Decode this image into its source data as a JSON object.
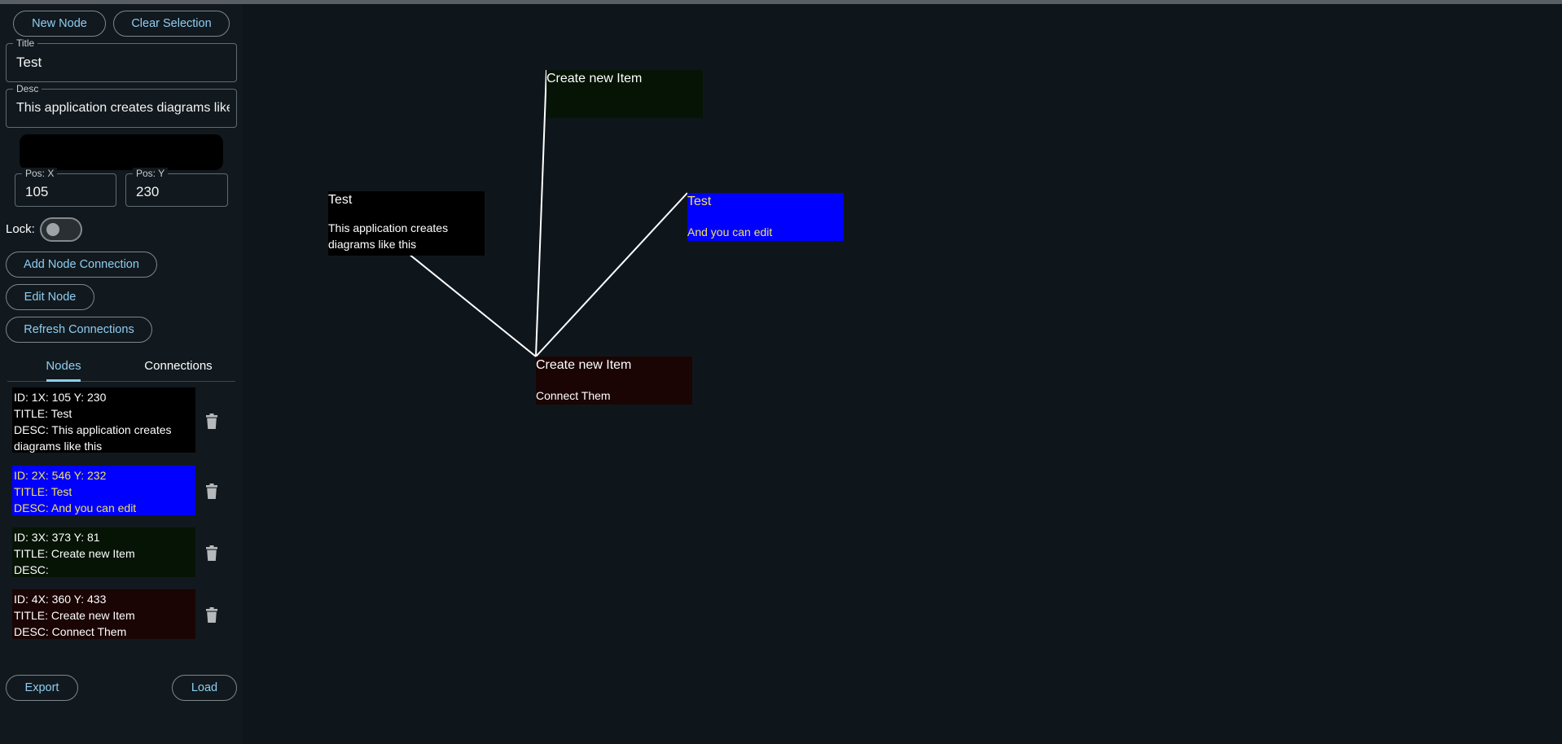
{
  "toolbar": {
    "new_node": "New Node",
    "clear_selection": "Clear Selection"
  },
  "form": {
    "title": {
      "label": "Title",
      "value": "Test"
    },
    "desc": {
      "label": "Desc",
      "value": "This application creates diagrams like this"
    },
    "pos_x": {
      "label": "Pos: X",
      "value": "105"
    },
    "pos_y": {
      "label": "Pos: Y",
      "value": "230"
    },
    "lock_label": "Lock:",
    "lock_on": false
  },
  "actions": {
    "add_connection": "Add Node Connection",
    "edit_node": "Edit Node",
    "refresh_connections": "Refresh Connections"
  },
  "tabs": {
    "nodes": "Nodes",
    "connections": "Connections",
    "active": "nodes"
  },
  "node_list": [
    {
      "id_line": "ID: 1X: 105 Y: 230",
      "title_line": "TITLE: Test",
      "desc_line": "DESC: This application creates",
      "desc_line2": "diagrams like this",
      "bg": "#000000",
      "fg": "#ffffff"
    },
    {
      "id_line": "ID: 2X: 546 Y: 232",
      "title_line": "TITLE: Test",
      "desc_line": "DESC: And you can edit",
      "bg": "#0000ff",
      "fg": "#f3e35a"
    },
    {
      "id_line": "ID: 3X: 373 Y: 81",
      "title_line": "TITLE: Create new Item",
      "desc_line": "DESC:",
      "bg": "#061406",
      "fg": "#ffffff"
    },
    {
      "id_line": "ID: 4X: 360 Y: 433",
      "title_line": "TITLE: Create new Item",
      "desc_line": "DESC: Connect Them",
      "bg": "#1a0404",
      "fg": "#ffffff"
    }
  ],
  "footer": {
    "export": "Export",
    "load": "Load"
  },
  "diagram": {
    "nodes": [
      {
        "title": "Test",
        "desc": "This application creates diagrams like this"
      },
      {
        "title": "Test",
        "desc": "And you can edit"
      },
      {
        "title": "Create new Item",
        "desc": ""
      },
      {
        "title": "Create new Item",
        "desc": "Connect Them"
      }
    ],
    "connections": [
      {
        "from": 1,
        "to": 4
      },
      {
        "from": 2,
        "to": 4
      },
      {
        "from": 3,
        "to": 4
      }
    ]
  },
  "colors": {
    "accent": "#8fcdf2",
    "edge": "#ffffff",
    "background": "#0f161b"
  }
}
